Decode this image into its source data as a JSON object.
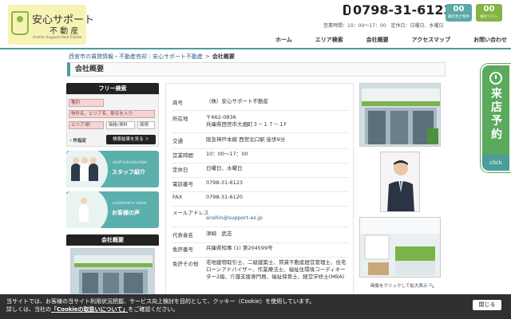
{
  "header": {
    "logo_name": "安心サポート",
    "logo_sub": "不 動 産",
    "logo_en": "Anshin Support Real Estate",
    "phone": "0798-31-6123",
    "hours": "営業時間：10：00〜17：00　定休日：日曜日、水曜日",
    "badges": [
      {
        "num": "00",
        "label": "最近見た物件"
      },
      {
        "num": "00",
        "label": "検討リスト"
      }
    ]
  },
  "nav": [
    "ホーム",
    "エリア検索",
    "会社概要",
    "アクセスマップ",
    "お問い合わせ"
  ],
  "breadcrumb": {
    "home": "西宮市の賃貸情報・不動産売却｜安心サポート不動産",
    "sep": ">",
    "current": "会社概要"
  },
  "page_title": "会社概要",
  "sidebar": {
    "search_head": "フリー検索",
    "fields": {
      "type": "種別",
      "keyword": "物件名、エリア名、駅名を入力",
      "area": "エリア/駅",
      "price": "価格/賃料",
      "layout": "面積"
    },
    "condition": "・件指定",
    "see_results": "検索結果を見る ＞",
    "banners": [
      {
        "en": "staff introduction",
        "jp": "スタッフ紹介"
      },
      {
        "en": "customer's voice",
        "jp": "お客様の声"
      }
    ],
    "company_head": "会社概要"
  },
  "company": [
    {
      "label": "商号",
      "value": "（株）安心サポート不動産"
    },
    {
      "label": "所在地",
      "value": "〒662-0836\n兵庫県西宮市大畑町３－１７－１F"
    },
    {
      "label": "交通",
      "value": "阪急神戸本線 西宮北口駅 徒歩9分"
    },
    {
      "label": "営業時間",
      "value": "10：00〜17：00"
    },
    {
      "label": "定休日",
      "value": "日曜日、水曜日"
    },
    {
      "label": "電話番号",
      "value": "0798-31-6123"
    },
    {
      "label": "FAX",
      "value": "0798-31-6120"
    },
    {
      "label": "メールアドレス",
      "value": "anshin@support-es.jp"
    },
    {
      "label": "代表者名",
      "value": "津崎　武志"
    },
    {
      "label": "免許番号",
      "value": "兵庫県知事 (1) 第204599号"
    },
    {
      "label": "免許その他",
      "value": "宅地建物取引士、二級建築士、賃貸不動産経営管理士、住宅ローンアドバイザー、作業療法士、福祉住環境コーディネーター2級、介護支援専門員、福祉保育士、経営学修士(MBA)"
    }
  ],
  "zoom_hint": "画像をクリックして拡大表示",
  "reserve": {
    "text": "来店予約",
    "click": "click"
  },
  "cookie": {
    "line1": "当サイトでは、お客様の当サイト利用状況把握、サービス向上検討を目的として、クッキー（Cookie）を使用しています。",
    "line2_pre": "詳しくは、当社の",
    "line2_link": "「Cookieの取扱いについて」",
    "line2_post": "をご確認ください。",
    "close": "閉じる"
  }
}
